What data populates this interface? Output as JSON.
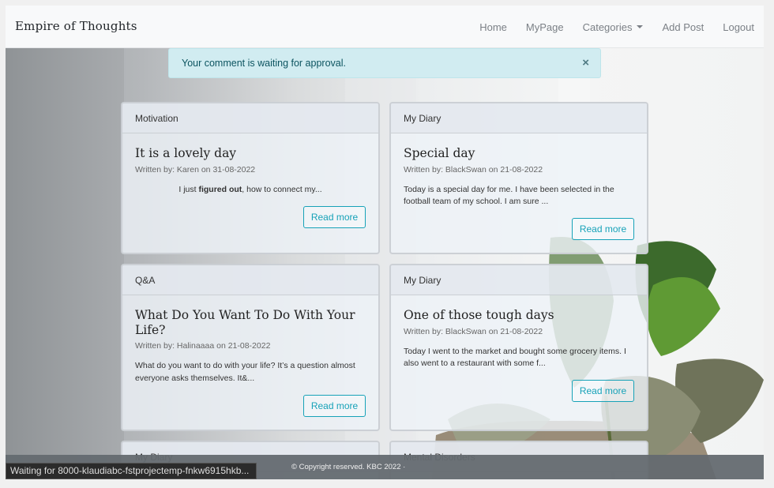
{
  "navbar": {
    "brand": "Empire of Thoughts",
    "links": [
      {
        "label": "Home"
      },
      {
        "label": "MyPage"
      },
      {
        "label": "Categories"
      },
      {
        "label": "Add Post"
      },
      {
        "label": "Logout"
      }
    ]
  },
  "alert": {
    "message": "Your comment is waiting for approval.",
    "close": "×"
  },
  "posts": [
    {
      "category": "Motivation",
      "title": "It is a lovely day",
      "meta": "Written by: Karen on 31-08-2022",
      "excerpt_pre": "I just ",
      "excerpt_bold": "figured out",
      "excerpt_post": ", how to connect my...",
      "button": "Read more"
    },
    {
      "category": "My Diary",
      "title": "Special day",
      "meta": "Written by: BlackSwan on 21-08-2022",
      "excerpt": "Today is a special day for me. I have been selected in the football team of my school. I am sure ...",
      "button": "Read more"
    },
    {
      "category": "Q&A",
      "title": "What Do You Want To Do With Your Life?",
      "meta": "Written by: Halinaaaa on 21-08-2022",
      "excerpt": "What do you want to do with your life? It’s a question almost everyone asks themselves. It&...",
      "button": "Read more"
    },
    {
      "category": "My Diary",
      "title": "One of those tough days",
      "meta": "Written by: BlackSwan on 21-08-2022",
      "excerpt": "Today I went to the market and bought some grocery items. I also went to a restaurant with some f...",
      "button": "Read more"
    },
    {
      "category": "My Diary"
    },
    {
      "category": "Mental Disorders"
    }
  ],
  "footer": {
    "copyright": "© Copyright reserved. KBC 2022 ·"
  },
  "status_bar": {
    "text": "Waiting for 8000-klaudiabc-fstprojectemp-fnkw6915hkb..."
  }
}
